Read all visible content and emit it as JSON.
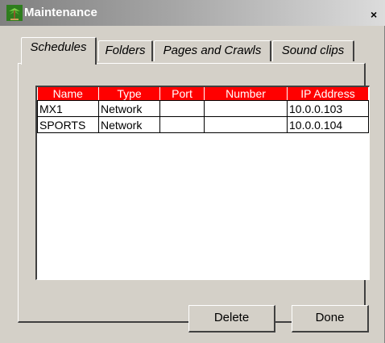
{
  "window": {
    "title": "Maintenance",
    "icon": "palm-tree-icon",
    "close_label": "×"
  },
  "tabs": [
    {
      "label": "Schedules",
      "active": true
    },
    {
      "label": "Folders",
      "active": false
    },
    {
      "label": "Pages and Crawls",
      "active": false
    },
    {
      "label": "Sound clips",
      "active": false
    }
  ],
  "table": {
    "header_color": "#ff0000",
    "columns": [
      "Name",
      "Type",
      "Port",
      "Number",
      "IP Address"
    ],
    "rows": [
      [
        "MX1",
        "Network",
        "",
        "",
        "10.0.0.103"
      ],
      [
        "SPORTS",
        "Network",
        "",
        "",
        "10.0.0.104"
      ]
    ]
  },
  "buttons": {
    "delete_label": "Delete",
    "done_label": "Done"
  }
}
